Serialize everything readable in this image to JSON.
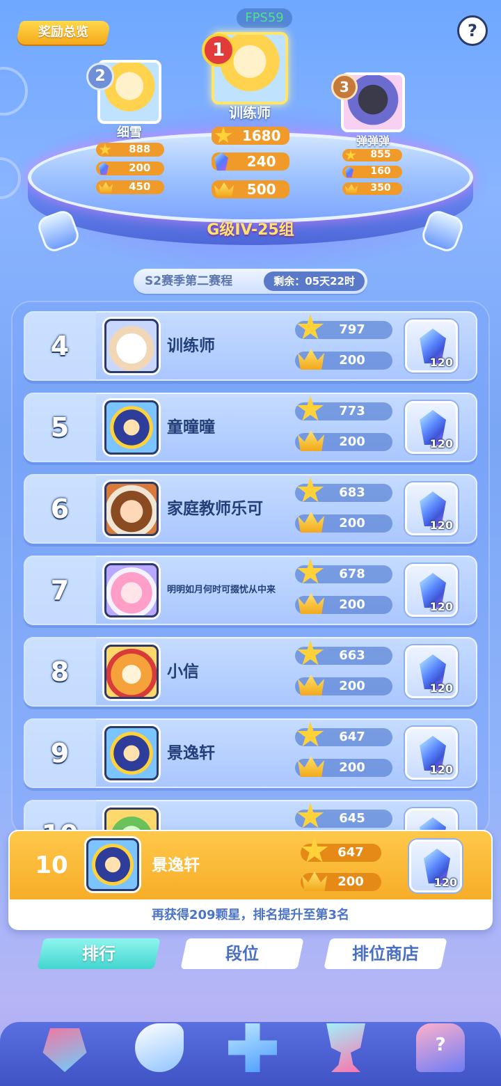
{
  "header": {
    "reward_overview": "奖励总览",
    "fps": "FPS59",
    "help": "?"
  },
  "podium": [
    {
      "place": "2",
      "name": "细雪",
      "stars": "888",
      "gems": "200",
      "crowns": "450"
    },
    {
      "place": "1",
      "name": "训练师",
      "stars": "1680",
      "gems": "240",
      "crowns": "500"
    },
    {
      "place": "3",
      "name": "弹弹弹",
      "stars": "855",
      "gems": "160",
      "crowns": "350"
    }
  ],
  "stage_title": "G级IV-25组",
  "season": {
    "name": "S2赛季第二赛程",
    "remaining": "剩余：05天22时"
  },
  "ranking": [
    {
      "rank": "4",
      "name": "训练师",
      "stars": "797",
      "crowns": "200",
      "reward": "120"
    },
    {
      "rank": "5",
      "name": "童曈曈",
      "stars": "773",
      "crowns": "200",
      "reward": "120"
    },
    {
      "rank": "6",
      "name": "家庭教师乐可",
      "stars": "683",
      "crowns": "200",
      "reward": "120"
    },
    {
      "rank": "7",
      "name": "明明如月何时可掇忧从中来",
      "stars": "678",
      "crowns": "200",
      "reward": "120"
    },
    {
      "rank": "8",
      "name": "小信",
      "stars": "663",
      "crowns": "200",
      "reward": "120"
    },
    {
      "rank": "9",
      "name": "景逸轩",
      "stars": "647",
      "crowns": "200",
      "reward": "120"
    },
    {
      "rank": "10",
      "name": "",
      "stars": "645",
      "crowns": "",
      "reward": ""
    }
  ],
  "my_rank": {
    "rank": "10",
    "name": "景逸轩",
    "stars": "647",
    "crowns": "200",
    "reward": "120",
    "tip": "再获得209颗星，排名提升至第3名"
  },
  "tabs": [
    "排行",
    "段位",
    "排位商店"
  ],
  "bottom_nav": [
    "rank-up-icon",
    "whistle-icon",
    "gamepad-icon",
    "trophy-icon",
    "mystery-box-icon"
  ],
  "colors": {
    "accent_gold": "#f7ad28",
    "tab_active": "#43d5cf",
    "stage_title": "#ffe36a"
  }
}
